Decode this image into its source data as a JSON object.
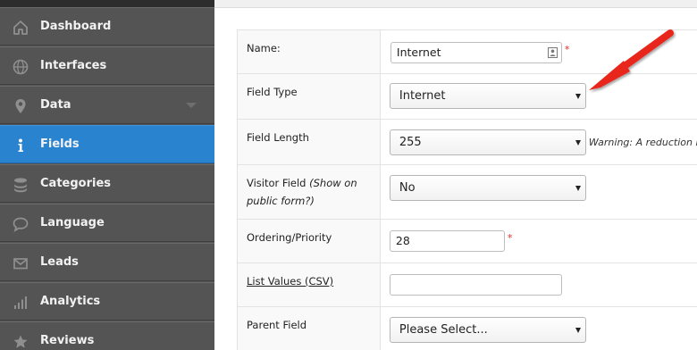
{
  "sidebar": {
    "items": [
      {
        "label": "Dashboard",
        "icon": "home-icon"
      },
      {
        "label": "Interfaces",
        "icon": "globe-icon"
      },
      {
        "label": "Data",
        "icon": "map-pin-icon"
      },
      {
        "label": "Fields",
        "icon": "info-icon",
        "active": true
      },
      {
        "label": "Categories",
        "icon": "layers-icon"
      },
      {
        "label": "Language",
        "icon": "speech-bubble-icon"
      },
      {
        "label": "Leads",
        "icon": "envelope-icon"
      },
      {
        "label": "Analytics",
        "icon": "bar-chart-icon"
      },
      {
        "label": "Reviews",
        "icon": "star-icon"
      }
    ]
  },
  "form": {
    "name": {
      "label": "Name:",
      "value": "Internet",
      "required_mark": "*"
    },
    "field_type": {
      "label": "Field Type",
      "value": "Internet"
    },
    "field_length": {
      "label": "Field Length",
      "value": "255",
      "warning": "Warning: A reduction in"
    },
    "visitor_field": {
      "label": "Visitor Field",
      "label_note": "(Show on public form?)",
      "value": "No"
    },
    "ordering": {
      "label": "Ordering/Priority",
      "value": "28",
      "required_mark": "*"
    },
    "list_values": {
      "label": "List Values (CSV)",
      "value": ""
    },
    "parent_field": {
      "label": "Parent Field",
      "value": "Please Select..."
    }
  },
  "colors": {
    "sidebar_bg": "#545454",
    "active_item": "#2a83cf",
    "required": "#e02b2b",
    "annotation_arrow": "#e8261f"
  }
}
